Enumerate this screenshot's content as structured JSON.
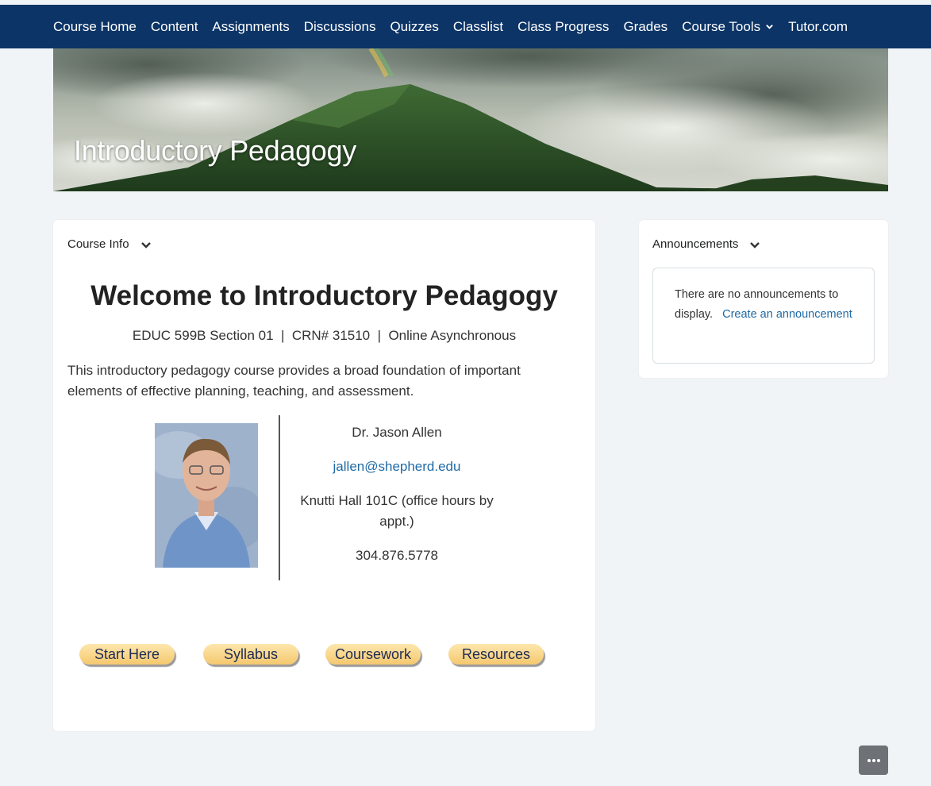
{
  "nav": {
    "items": [
      "Course Home",
      "Content",
      "Assignments",
      "Discussions",
      "Quizzes",
      "Classlist",
      "Class Progress",
      "Grades",
      "Course Tools",
      "Tutor.com"
    ]
  },
  "banner": {
    "title": "Introductory Pedagogy"
  },
  "course_info": {
    "header": "Course Info",
    "welcome": "Welcome to Introductory Pedagogy",
    "subline": "EDUC 599B Section 01  |  CRN# 31510  |  Online Asynchronous",
    "description": "This introductory pedagogy course provides a broad foundation of important elements of effective planning, teaching, and assessment.",
    "instructor": {
      "name": "Dr. Jason Allen",
      "email": "jallen@shepherd.edu",
      "office": "Knutti Hall 101C (office hours by appt.)",
      "phone": "304.876.5778"
    },
    "buttons": [
      "Start Here",
      "Syllabus",
      "Coursework",
      "Resources"
    ]
  },
  "announcements": {
    "header": "Announcements",
    "empty_text": "There are no announcements to display.",
    "create_link": "Create an announcement"
  },
  "colors": {
    "nav_bg": "#0c3466",
    "link": "#1f6aa5",
    "pill": "#f5c86e"
  }
}
